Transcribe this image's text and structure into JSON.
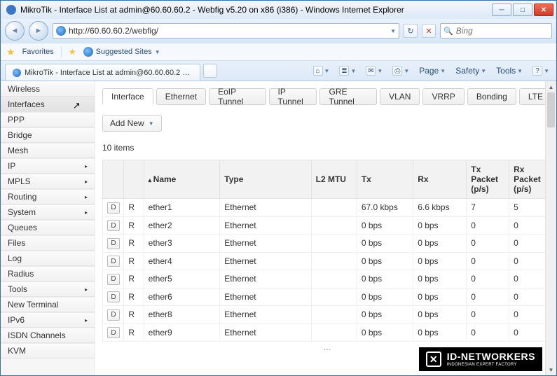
{
  "window": {
    "title": "MikroTik - Interface List at admin@60.60.60.2 - Webfig v5.20 on x86 (i386) - Windows Internet Explorer"
  },
  "nav": {
    "url": "http://60.60.60.2/webfig/",
    "search_placeholder": "Bing"
  },
  "favorites": {
    "label": "Favorites",
    "suggested": "Suggested Sites"
  },
  "ie_tab": {
    "label": "MikroTik - Interface List at admin@60.60.60.2 - W..."
  },
  "cmd": {
    "page": "Page",
    "safety": "Safety",
    "tools": "Tools"
  },
  "sidebar": {
    "items": [
      {
        "label": "Wireless",
        "submenu": false
      },
      {
        "label": "Interfaces",
        "submenu": false,
        "active": true,
        "cursor": true
      },
      {
        "label": "PPP",
        "submenu": false
      },
      {
        "label": "Bridge",
        "submenu": false
      },
      {
        "label": "Mesh",
        "submenu": false
      },
      {
        "label": "IP",
        "submenu": true
      },
      {
        "label": "MPLS",
        "submenu": true
      },
      {
        "label": "Routing",
        "submenu": true
      },
      {
        "label": "System",
        "submenu": true
      },
      {
        "label": "Queues",
        "submenu": false
      },
      {
        "label": "Files",
        "submenu": false
      },
      {
        "label": "Log",
        "submenu": false
      },
      {
        "label": "Radius",
        "submenu": false
      },
      {
        "label": "Tools",
        "submenu": true
      },
      {
        "label": "New Terminal",
        "submenu": false
      },
      {
        "label": "IPv6",
        "submenu": true
      },
      {
        "label": "ISDN Channels",
        "submenu": false
      },
      {
        "label": "KVM",
        "submenu": false
      }
    ]
  },
  "tabs": [
    "Interface",
    "Ethernet",
    "EoIP Tunnel",
    "IP Tunnel",
    "GRE Tunnel",
    "VLAN",
    "VRRP",
    "Bonding",
    "LTE"
  ],
  "addnew": "Add New",
  "count_label": "10 items",
  "columns": {
    "d": "D",
    "flag": "",
    "name": "Name",
    "type": "Type",
    "l2mtu": "L2 MTU",
    "tx": "Tx",
    "rx": "Rx",
    "txp": "Tx Packet (p/s)",
    "rxp": "Rx Packet (p/s)"
  },
  "rows": [
    {
      "flag": "R",
      "name": "ether1",
      "type": "Ethernet",
      "l2mtu": "",
      "tx": "67.0 kbps",
      "rx": "6.6 kbps",
      "txp": "7",
      "rxp": "5"
    },
    {
      "flag": "R",
      "name": "ether2",
      "type": "Ethernet",
      "l2mtu": "",
      "tx": "0 bps",
      "rx": "0 bps",
      "txp": "0",
      "rxp": "0"
    },
    {
      "flag": "R",
      "name": "ether3",
      "type": "Ethernet",
      "l2mtu": "",
      "tx": "0 bps",
      "rx": "0 bps",
      "txp": "0",
      "rxp": "0"
    },
    {
      "flag": "R",
      "name": "ether4",
      "type": "Ethernet",
      "l2mtu": "",
      "tx": "0 bps",
      "rx": "0 bps",
      "txp": "0",
      "rxp": "0"
    },
    {
      "flag": "R",
      "name": "ether5",
      "type": "Ethernet",
      "l2mtu": "",
      "tx": "0 bps",
      "rx": "0 bps",
      "txp": "0",
      "rxp": "0"
    },
    {
      "flag": "R",
      "name": "ether6",
      "type": "Ethernet",
      "l2mtu": "",
      "tx": "0 bps",
      "rx": "0 bps",
      "txp": "0",
      "rxp": "0"
    },
    {
      "flag": "R",
      "name": "ether8",
      "type": "Ethernet",
      "l2mtu": "",
      "tx": "0 bps",
      "rx": "0 bps",
      "txp": "0",
      "rxp": "0"
    },
    {
      "flag": "R",
      "name": "ether9",
      "type": "Ethernet",
      "l2mtu": "",
      "tx": "0 bps",
      "rx": "0 bps",
      "txp": "0",
      "rxp": "0"
    }
  ],
  "watermark": {
    "brand": "ID-NETWORKERS",
    "tag": "INDONESIAN EXPERT FACTORY"
  }
}
